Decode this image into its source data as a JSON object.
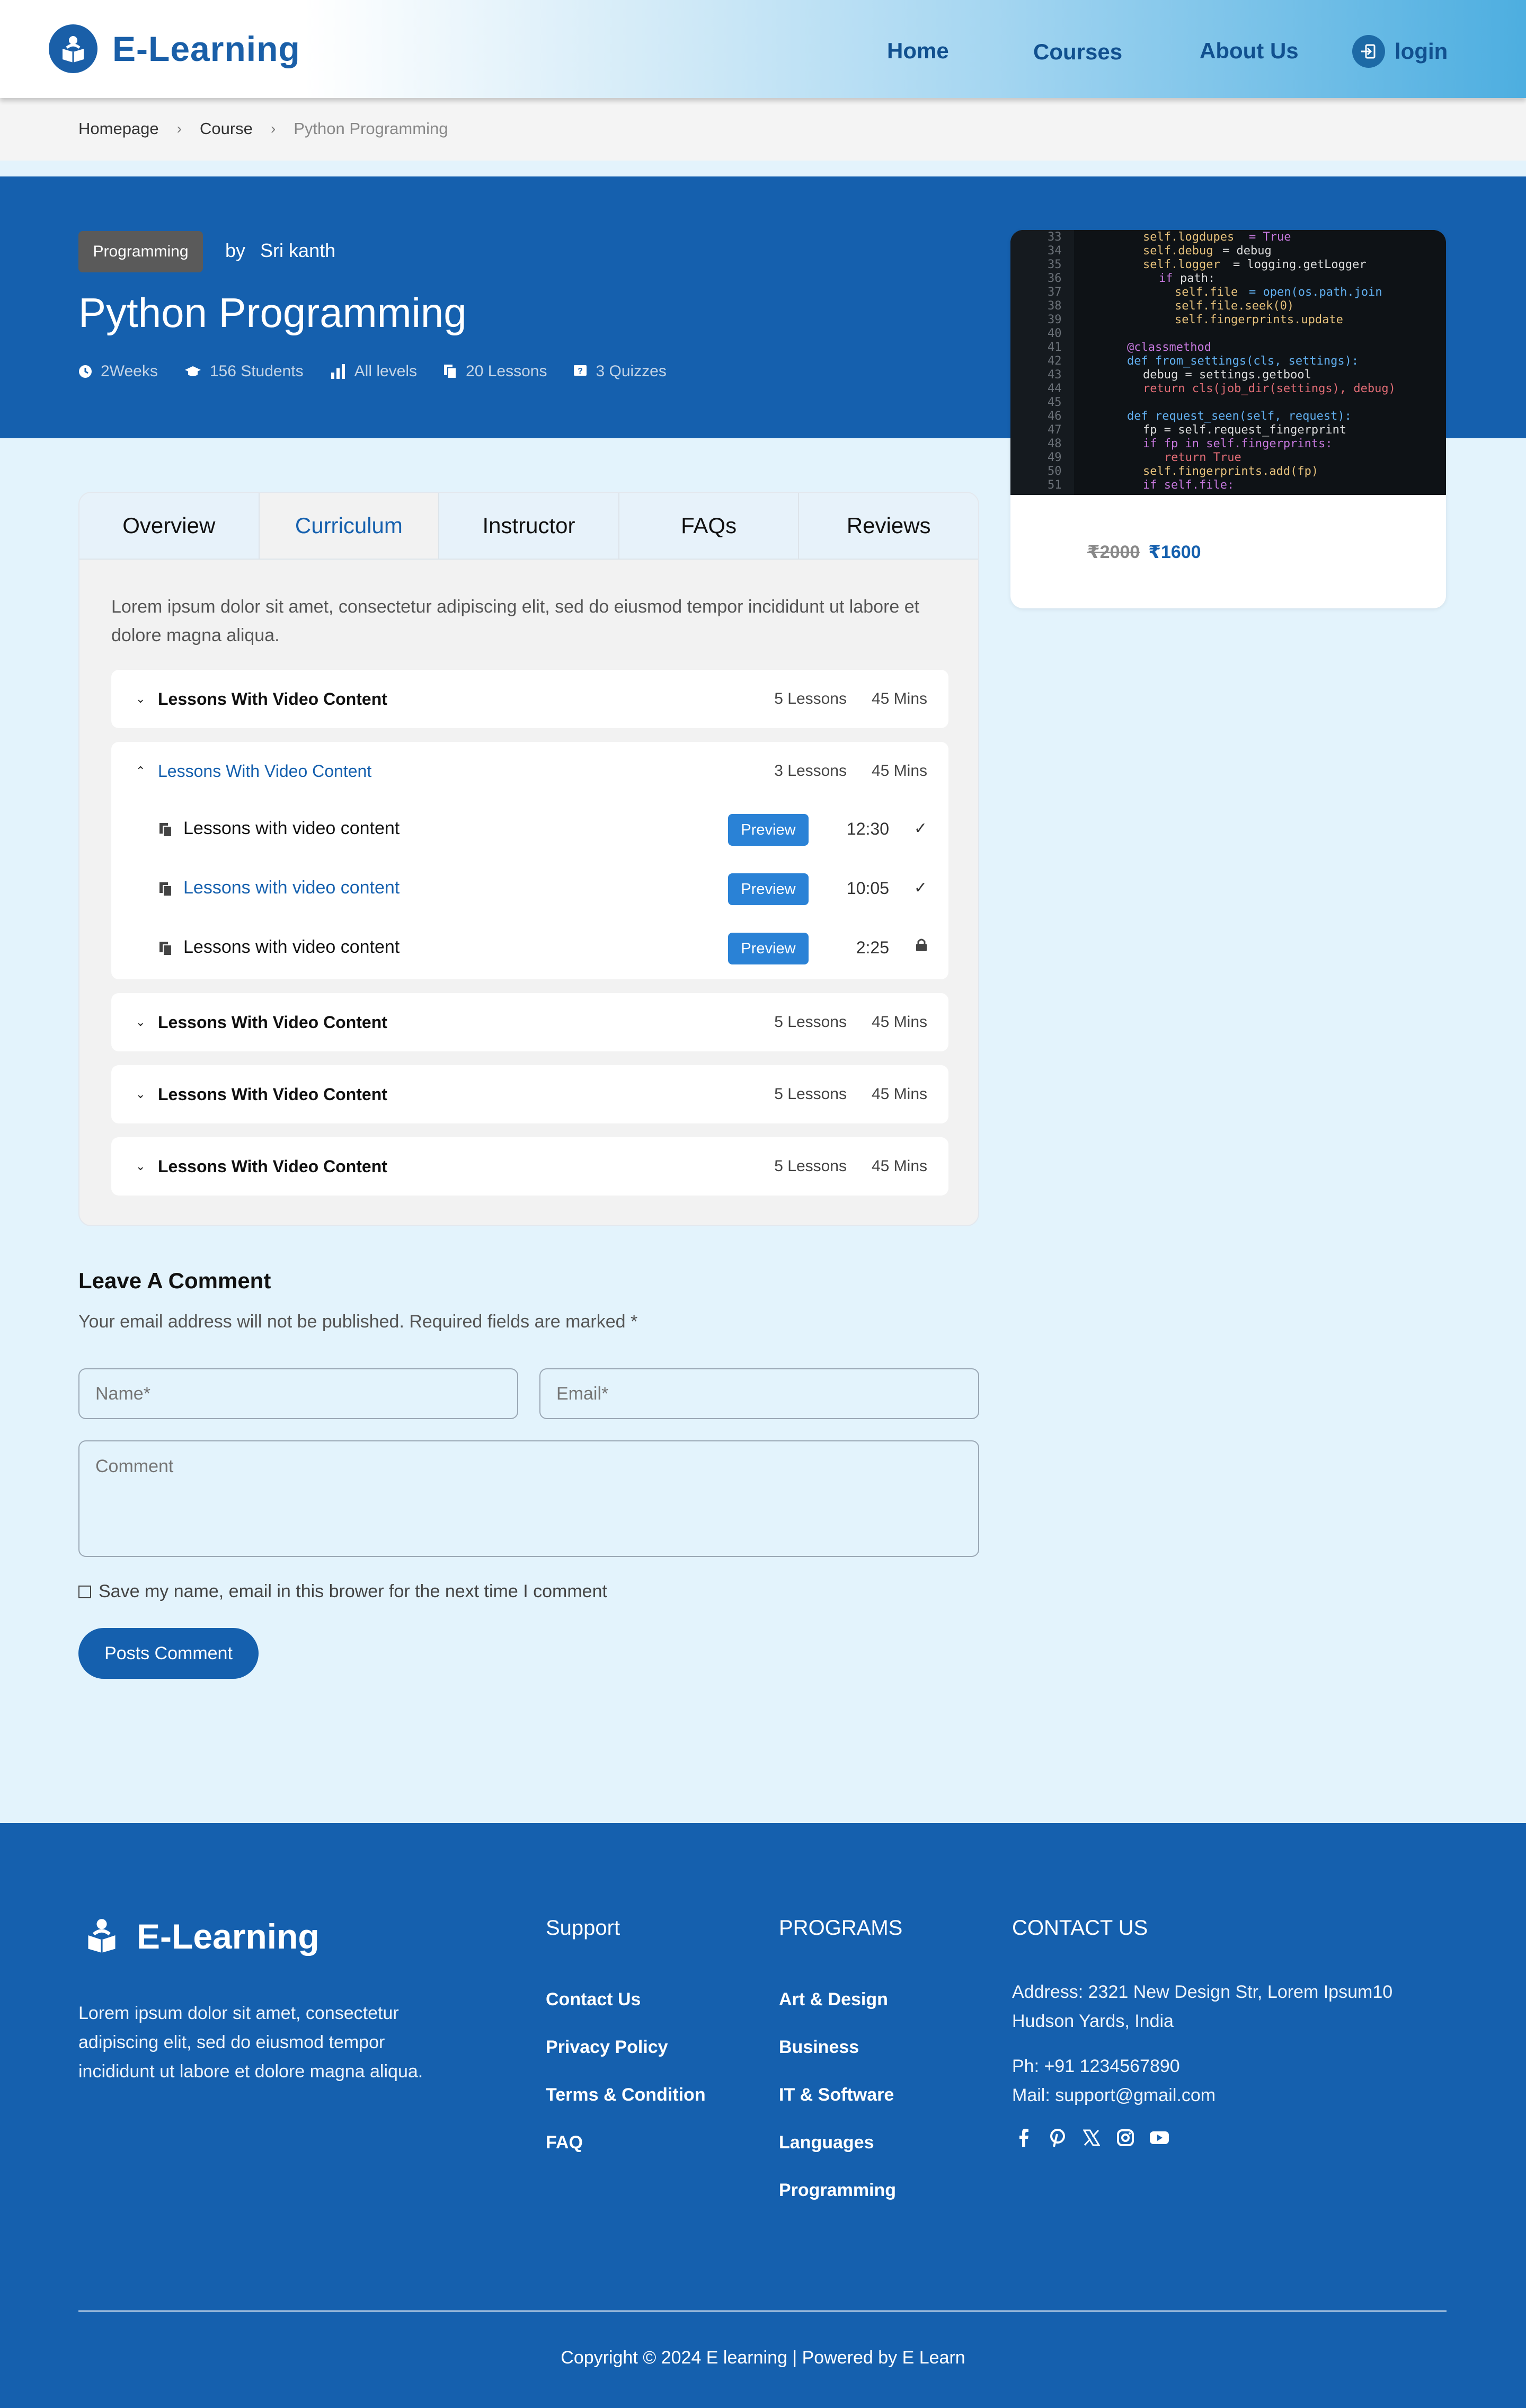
{
  "header": {
    "brand": "E-Learning",
    "nav": [
      {
        "label": "Home"
      },
      {
        "label": "Courses"
      },
      {
        "label": "About Us"
      }
    ],
    "login_label": "login"
  },
  "breadcrumb": {
    "items": [
      "Homepage",
      "Course",
      "Python Programming"
    ]
  },
  "course": {
    "category": "Programming",
    "by_label": "by",
    "instructor": "Sri kanth",
    "title": "Python Programming",
    "meta": [
      {
        "icon": "clock-icon",
        "label": "2Weeks"
      },
      {
        "icon": "graduation-cap-icon",
        "label": "156 Students"
      },
      {
        "icon": "bar-chart-icon",
        "label": "All levels"
      },
      {
        "icon": "file-icon",
        "label": "20 Lessons"
      },
      {
        "icon": "quiz-icon",
        "label": "3 Quizzes"
      }
    ],
    "old_price": "₹2000",
    "new_price": "₹1600"
  },
  "tabs": [
    "Overview",
    "Curriculum",
    "Instructor",
    "FAQs",
    "Reviews"
  ],
  "active_tab": "Curriculum",
  "curriculum": {
    "intro": "Lorem ipsum dolor sit amet, consectetur adipiscing elit, sed do eiusmod tempor incididunt ut labore et dolore magna aliqua.",
    "sections": [
      {
        "title": "Lessons With Video Content",
        "lessons": "5 Lessons",
        "mins": "45 Mins",
        "open": false
      },
      {
        "title": "Lessons With Video Content",
        "lessons": "3 Lessons",
        "mins": "45 Mins",
        "open": true,
        "items": [
          {
            "title": "Lessons with video content",
            "preview": "Preview",
            "time": "12:30",
            "status": "check-icon"
          },
          {
            "title": "Lessons with video content",
            "preview": "Preview",
            "time": "10:05",
            "status": "check-icon"
          },
          {
            "title": "Lessons with video content",
            "preview": "Preview",
            "time": "2:25",
            "status": "lock-icon"
          }
        ]
      },
      {
        "title": "Lessons With Video Content",
        "lessons": "5 Lessons",
        "mins": "45 Mins",
        "open": false
      },
      {
        "title": "Lessons With Video Content",
        "lessons": "5 Lessons",
        "mins": "45 Mins",
        "open": false
      },
      {
        "title": "Lessons With Video Content",
        "lessons": "5 Lessons",
        "mins": "45 Mins",
        "open": false
      }
    ]
  },
  "comment": {
    "title": "Leave A Comment",
    "subtitle": "Your email address will not be published. Required fields are marked *",
    "name_placeholder": "Name*",
    "email_placeholder": "Email*",
    "comment_placeholder": "Comment",
    "save_label": "Save my name, email in this brower for the next time I comment",
    "submit_label": "Posts Comment"
  },
  "footer": {
    "brand": "E-Learning",
    "description": "Lorem ipsum dolor sit amet, consectetur adipiscing elit, sed do eiusmod tempor incididunt ut labore et dolore magna aliqua.",
    "support_title": "Support",
    "support_links": [
      "Contact Us",
      "Privacy Policy",
      "Terms & Condition",
      "FAQ"
    ],
    "programs_title": "PROGRAMS",
    "programs_links": [
      "Art & Design",
      "Business",
      "IT & Software",
      "Languages",
      "Programming"
    ],
    "contact_title": "CONTACT US",
    "address": "Address: 2321 New Design Str, Lorem Ipsum10 Hudson Yards, India",
    "phone": "Ph: +91 1234567890",
    "mail": "Mail: support@gmail.com",
    "socials": [
      "facebook-icon",
      "pinterest-icon",
      "x-icon",
      "instagram-icon",
      "youtube-icon"
    ],
    "copyright": "Copyright © 2024 E learning | Powered by E Learn"
  },
  "colors": {
    "primary": "#1560ae",
    "accent": "#2a82d6",
    "page_bg": "#e3f3fc"
  }
}
